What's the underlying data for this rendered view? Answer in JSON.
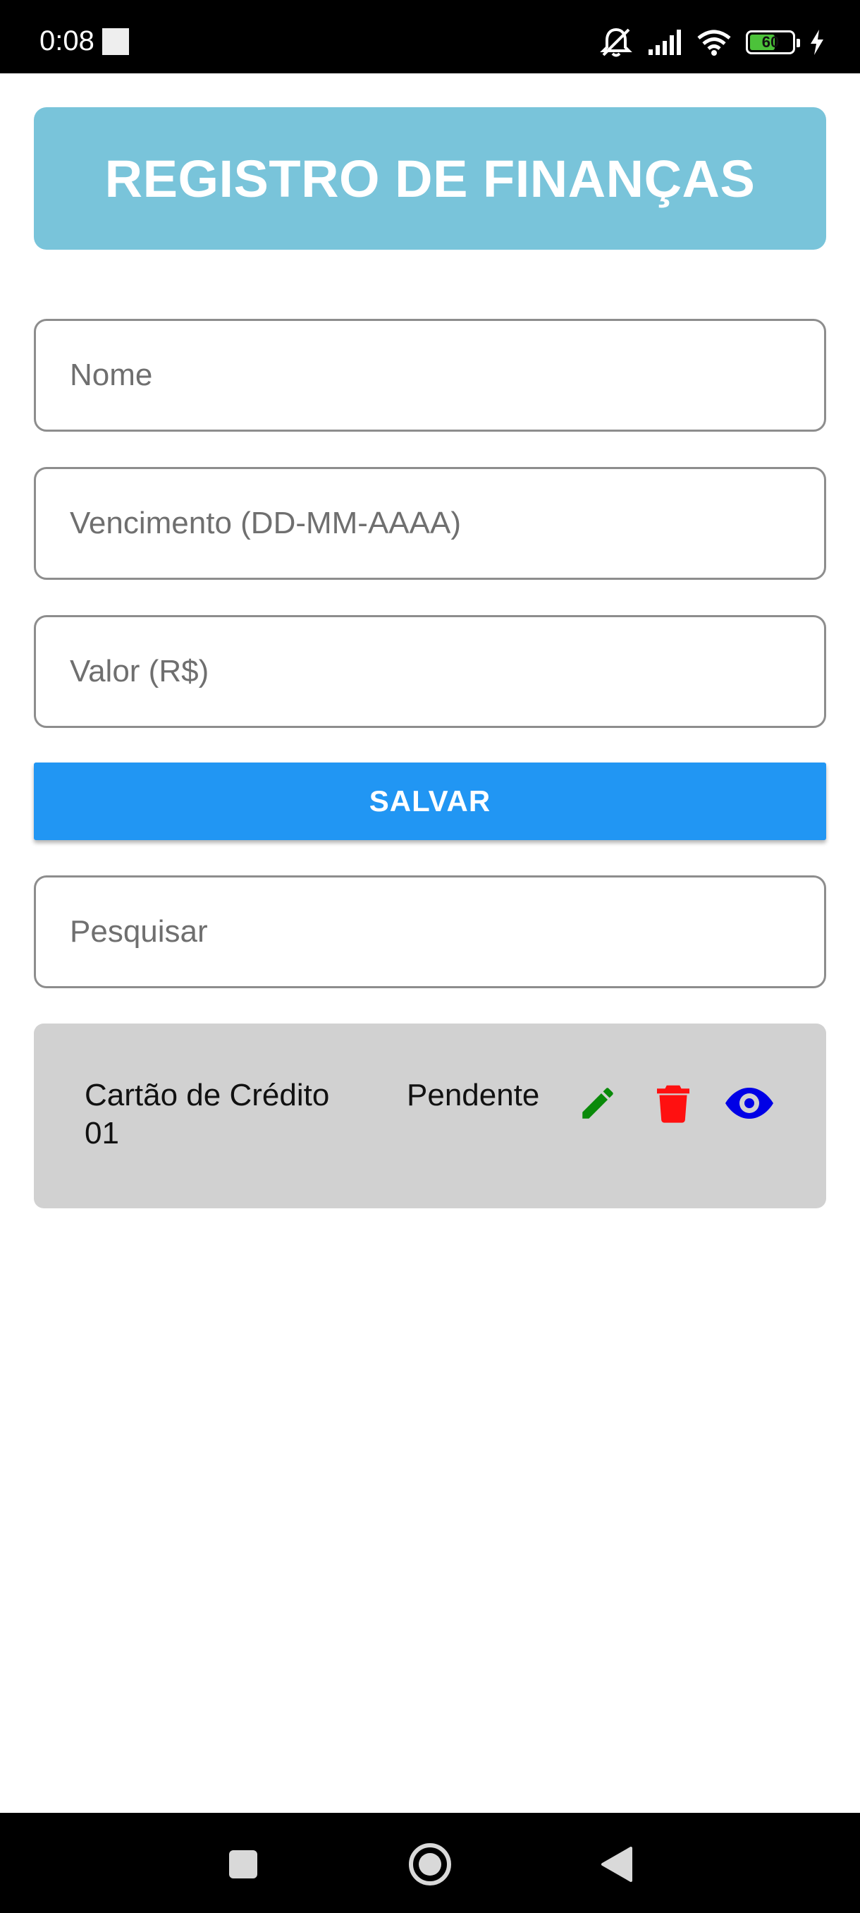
{
  "status_bar": {
    "time": "0:08",
    "battery_level": "60",
    "battery_fraction": 0.6,
    "icons": [
      "notification-square-icon",
      "mute-icon",
      "signal-icon",
      "wifi-icon",
      "battery-icon",
      "charging-icon"
    ]
  },
  "header": {
    "title": "REGISTRO DE FINANÇAS"
  },
  "form": {
    "name_placeholder": "Nome",
    "name_value": "",
    "due_placeholder": "Vencimento (DD-MM-AAAA)",
    "due_value": "",
    "amount_placeholder": "Valor (R$)",
    "amount_value": "",
    "save_label": "SALVAR"
  },
  "search": {
    "placeholder": "Pesquisar",
    "value": ""
  },
  "items": [
    {
      "name": "Cartão de Crédito 01",
      "status": "Pendente",
      "icons": [
        "edit-icon",
        "trash-icon",
        "eye-icon"
      ]
    }
  ],
  "colors": {
    "header_bg": "#79c4da",
    "save_button_bg": "#2196f3",
    "list_item_bg": "#d1d1d1",
    "edit_icon": "#0a8a0a",
    "delete_icon": "#ff1010",
    "view_icon": "#0000e6"
  },
  "nav_bar": {
    "icons": [
      "recents-square-icon",
      "home-circle-icon",
      "back-triangle-icon"
    ]
  }
}
